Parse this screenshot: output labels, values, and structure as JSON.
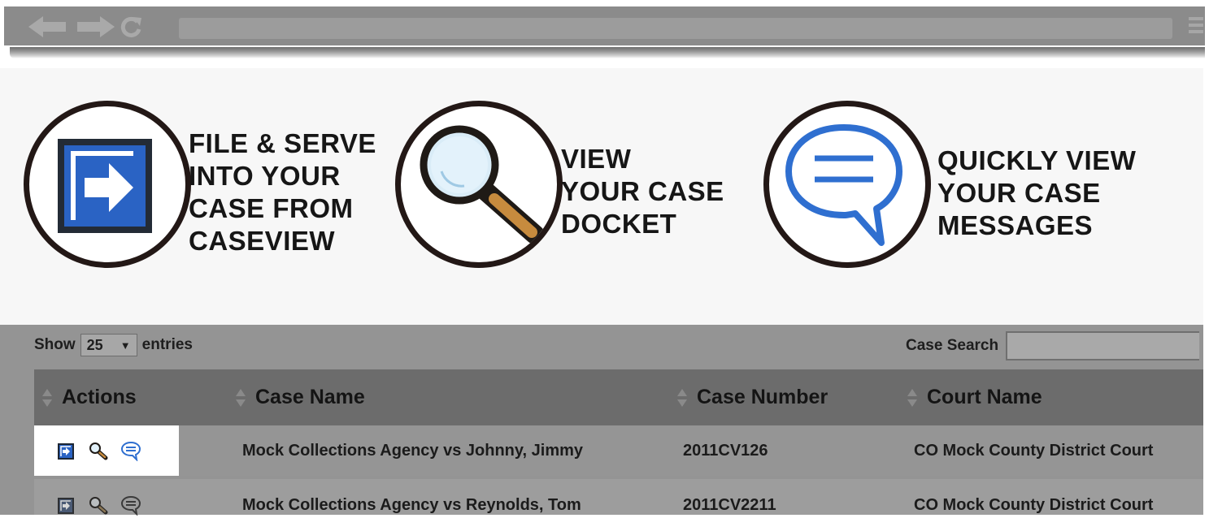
{
  "browser": {
    "icons": [
      "back-arrow-icon",
      "forward-arrow-icon",
      "reload-icon",
      "menu-icon"
    ]
  },
  "features": [
    {
      "icon": "file-serve-arrow-icon",
      "lines": [
        "FILE & SERVE",
        "INTO YOUR",
        "CASE FROM",
        "CASEVIEW"
      ]
    },
    {
      "icon": "magnifying-glass-icon",
      "lines": [
        "VIEW",
        "YOUR CASE",
        "DOCKET"
      ]
    },
    {
      "icon": "speech-bubble-icon",
      "lines": [
        "QUICKLY VIEW",
        "YOUR CASE",
        "MESSAGES"
      ]
    }
  ],
  "table": {
    "show_label": "Show",
    "page_size": "25",
    "entries_label": "entries",
    "search_label": "Case Search",
    "search_value": "",
    "columns": [
      "Actions",
      "Case Name",
      "Case Number",
      "Court Name"
    ],
    "rows": [
      {
        "case_name": "Mock Collections Agency vs Johnny, Jimmy",
        "case_number": "2011CV126",
        "court_name": "CO Mock County District Court"
      },
      {
        "case_name": "Mock Collections Agency vs Reynolds, Tom",
        "case_number": "2011CV2211",
        "court_name": "CO Mock County District Court"
      }
    ]
  },
  "colors": {
    "accent_blue": "#2f6fd0",
    "file_icon_blue": "#2a63c4",
    "circle_border": "#231816",
    "header_bg": "#6c6c6c"
  }
}
